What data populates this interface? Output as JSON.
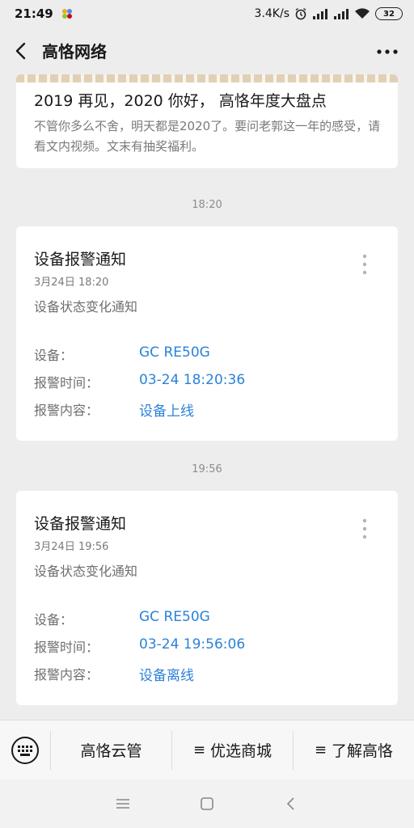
{
  "status_bar": {
    "time": "21:49",
    "network_speed": "3.4K/s",
    "battery": "32"
  },
  "header": {
    "title": "高恪网络"
  },
  "article": {
    "title": "2019 再见，2020 你好， 高恪年度大盘点",
    "description": "不管你多么不舍，明天都是2020了。要问老郭这一年的感受，请看文内视频。文末有抽奖福利。"
  },
  "messages": [
    {
      "timestamp": "18:20",
      "title": "设备报警通知",
      "date": "3月24日  18:20",
      "subtitle": "设备状态变化通知",
      "fields": [
        {
          "label": "设备：",
          "value": "GC RE50G"
        },
        {
          "label": "报警时间：",
          "value": "03-24 18:20:36"
        },
        {
          "label": "报警内容：",
          "value": "设备上线"
        }
      ]
    },
    {
      "timestamp": "19:56",
      "title": "设备报警通知",
      "date": "3月24日  19:56",
      "subtitle": "设备状态变化通知",
      "fields": [
        {
          "label": "设备：",
          "value": "GC RE50G"
        },
        {
          "label": "报警时间：",
          "value": "03-24 19:56:06"
        },
        {
          "label": "报警内容：",
          "value": "设备离线"
        }
      ]
    }
  ],
  "bottom_menu": {
    "items": [
      {
        "prefix": "",
        "label": "高恪云管"
      },
      {
        "prefix": "≡",
        "label": "优选商城"
      },
      {
        "prefix": "≡",
        "label": "了解高恪"
      }
    ]
  },
  "colors": {
    "background": "#ededed",
    "card": "#ffffff",
    "link_blue": "#2b82d9",
    "secondary_text": "#7a7a7a"
  },
  "icons": [
    "back-arrow-icon",
    "more-dots-icon",
    "kebab-icon",
    "keyboard-icon",
    "menu-lines-icon",
    "home-square-icon",
    "back-chevron-icon",
    "wifi-icon",
    "signal-icon",
    "alarm-icon",
    "battery-icon"
  ]
}
